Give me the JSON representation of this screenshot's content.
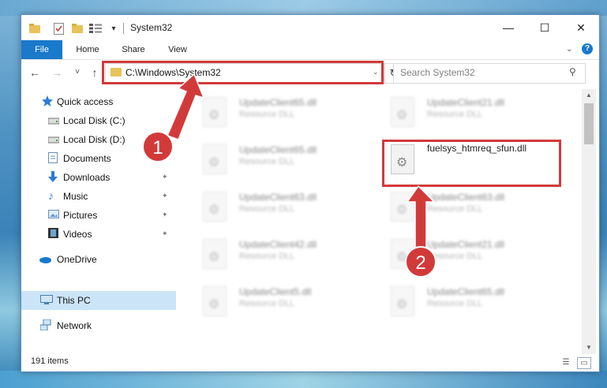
{
  "window": {
    "title": "System32"
  },
  "titlebar": {
    "minimize": "—",
    "maximize": "☐",
    "close": "✕",
    "dropdown": "▾"
  },
  "ribbon": {
    "tabs": [
      "File",
      "Home",
      "Share",
      "View"
    ],
    "help": "?",
    "expand": "⌄"
  },
  "navigation": {
    "back": "←",
    "forward": "→",
    "recent": "˅",
    "up": "↑"
  },
  "address": {
    "path": "C:\\Windows\\System32",
    "dropdown": "⌄",
    "refresh": "↻"
  },
  "search": {
    "placeholder": "Search System32",
    "icon": "⚲"
  },
  "sidebar": {
    "items": [
      {
        "label": "Quick access",
        "icon": "star-icon"
      },
      {
        "label": "Local Disk (C:)",
        "icon": "drive-icon"
      },
      {
        "label": "Local Disk (D:)",
        "icon": "drive-icon"
      },
      {
        "label": "Documents",
        "icon": "documents-icon"
      },
      {
        "label": "Downloads",
        "icon": "download-icon"
      },
      {
        "label": "Music",
        "icon": "music-icon"
      },
      {
        "label": "Pictures",
        "icon": "pictures-icon"
      },
      {
        "label": "Videos",
        "icon": "videos-icon"
      },
      {
        "label": "OneDrive",
        "icon": "cloud-icon"
      },
      {
        "label": "This PC",
        "icon": "computer-icon"
      },
      {
        "label": "Network",
        "icon": "network-icon"
      }
    ],
    "pin": "📌"
  },
  "files": [
    {
      "name": "UpdateClient65.dll",
      "type": "Resource DLL"
    },
    {
      "name": "UpdateClient21.dll",
      "type": "Resource DLL"
    },
    {
      "name": "UpdateClient65.dll",
      "type": "Resource DLL"
    },
    {
      "name": "fuelsys_htmreq_sfun.dll",
      "type": ""
    },
    {
      "name": "UpdateClient63.dll",
      "type": "Resource DLL"
    },
    {
      "name": "UpdateClient63.dll",
      "type": "Resource DLL"
    },
    {
      "name": "UpdateClient42.dll",
      "type": "Resource DLL"
    },
    {
      "name": "UpdateClient21.dll",
      "type": "Resource DLL"
    },
    {
      "name": "UpdateClient5.dll",
      "type": "Resource DLL"
    },
    {
      "name": "UpdateClient65.dll",
      "type": "Resource DLL"
    }
  ],
  "status": {
    "item_count": "191 items"
  },
  "callouts": [
    "1",
    "2"
  ],
  "colors": {
    "accent": "#1979ca",
    "highlight": "#d23a3a",
    "selected": "#cce4f7"
  }
}
